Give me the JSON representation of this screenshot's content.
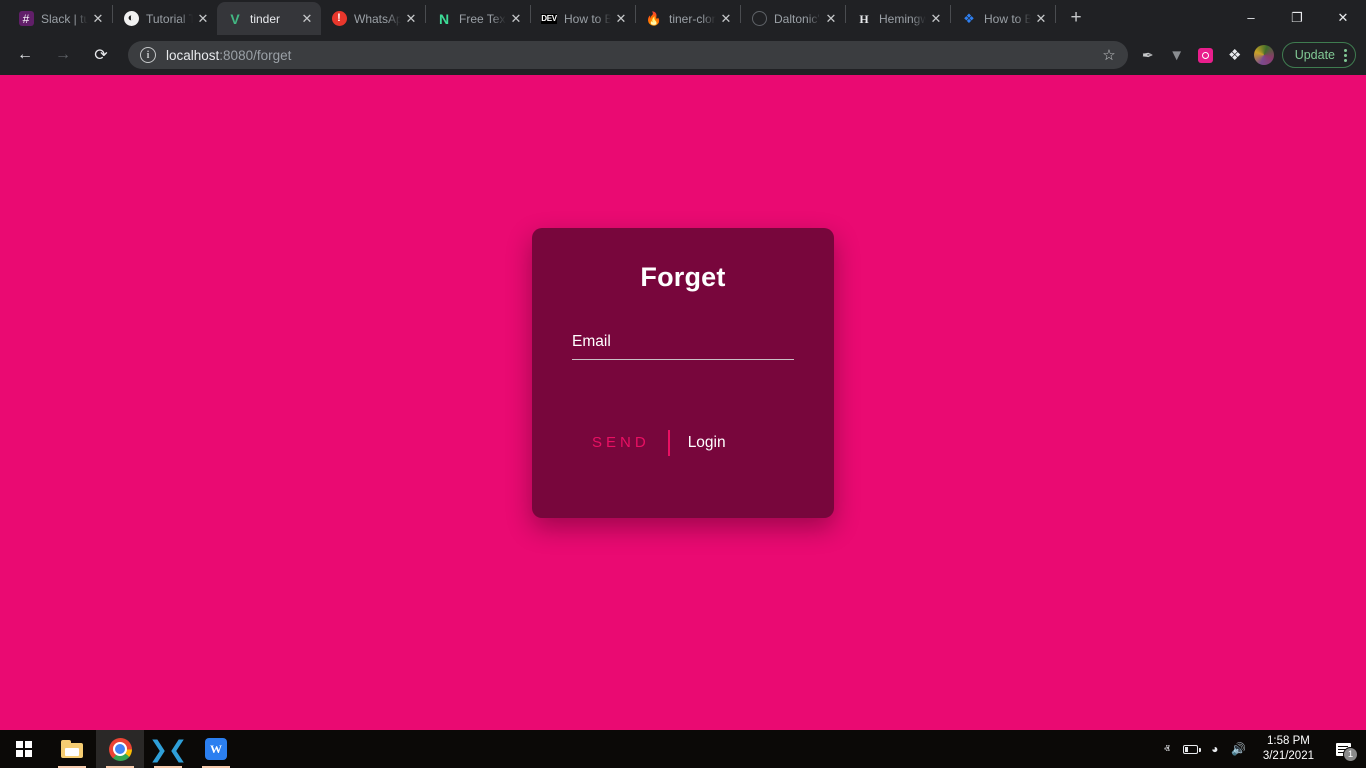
{
  "browser": {
    "tabs": [
      {
        "title": "Slack | tu",
        "icon": "slack-icon",
        "glyph": "#",
        "active": false
      },
      {
        "title": "Tutorial T",
        "icon": "globe-dark-icon",
        "glyph": "◕",
        "active": false
      },
      {
        "title": "tinder",
        "icon": "vue-icon",
        "glyph": "V",
        "active": true
      },
      {
        "title": "WhatsAp",
        "icon": "alert-circle-icon",
        "glyph": "!",
        "active": false
      },
      {
        "title": "Free Text",
        "icon": "netlify-n-icon",
        "glyph": "N",
        "active": false
      },
      {
        "title": "How to B",
        "icon": "dev-badge-icon",
        "glyph": "DEV",
        "active": false
      },
      {
        "title": "tiner-clon",
        "icon": "firebase-flame-icon",
        "glyph": "🔥",
        "active": false
      },
      {
        "title": "Daltonic's",
        "icon": "github-icon",
        "glyph": "",
        "active": false
      },
      {
        "title": "Hemingw",
        "icon": "hemingway-h-icon",
        "glyph": "H",
        "active": false
      },
      {
        "title": "How to B",
        "icon": "layers-blue-icon",
        "glyph": "❖",
        "active": false
      }
    ],
    "tab_close_label": "✕",
    "new_tab_label": "+",
    "window_controls": {
      "minimize": "–",
      "maximize": "❐",
      "close": "✕"
    },
    "toolbar": {
      "back_label": "←",
      "forward_label": "→",
      "reload_label": "⟳",
      "site_info_label": "i",
      "url_host": "localhost",
      "url_path": ":8080/forget",
      "bookmark_label": "☆",
      "extension_eyedropper": "✒",
      "extension_vue": "V",
      "extension_pink": "",
      "extensions_puzzle": "❖",
      "update_label": "Update"
    }
  },
  "page": {
    "title": "Forget",
    "email_placeholder": "Email",
    "email_value": "",
    "send_label": "SEND",
    "login_label": "Login",
    "colors": {
      "background": "#ea0a72",
      "card": "#78063c",
      "accent": "#e91063",
      "text": "#ffffff"
    }
  },
  "taskbar": {
    "start_label": "Start",
    "apps": [
      {
        "name": "file-explorer",
        "label": "File Explorer"
      },
      {
        "name": "google-chrome",
        "label": "Google Chrome"
      },
      {
        "name": "visual-studio-code",
        "label": "Visual Studio Code"
      },
      {
        "name": "wps-office",
        "label": "WPS Office"
      }
    ],
    "tray": {
      "show_hidden_label": "ⱏ",
      "battery_label": "Battery",
      "network_label": "Network",
      "volume_label": "Volume",
      "time": "1:58 PM",
      "date": "3/21/2021",
      "notification_count": "1"
    }
  }
}
